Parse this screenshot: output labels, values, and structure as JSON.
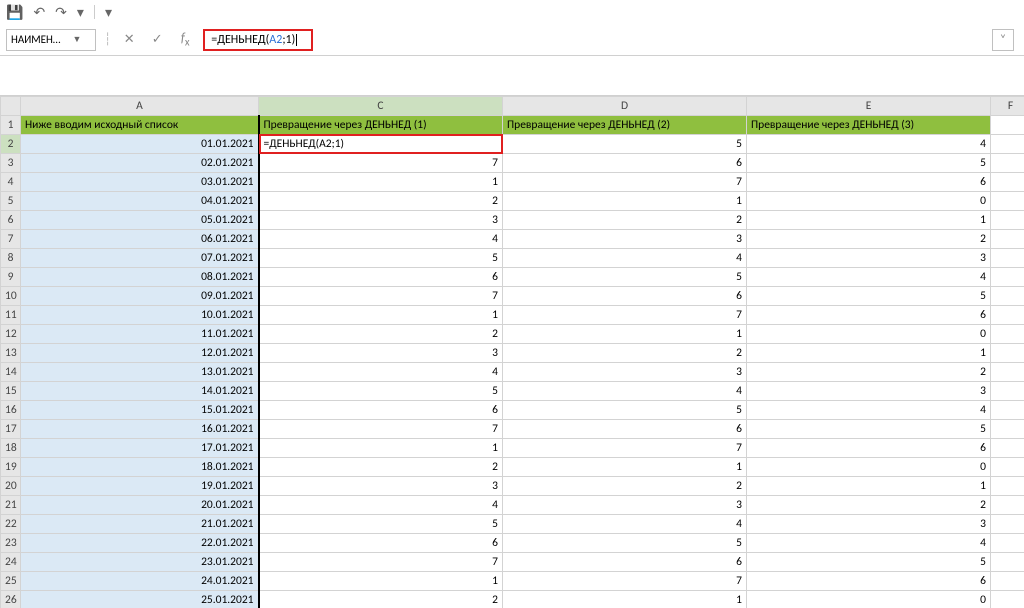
{
  "qat": {
    "save": "💾",
    "undo": "↶",
    "redo": "↷",
    "more": "⋯"
  },
  "namebox": {
    "value": "НАИМЕН…"
  },
  "formula": {
    "prefix": "=ДЕНЬНЕД(",
    "ref": "A2",
    "suffix": ";1)"
  },
  "columns": [
    "A",
    "C",
    "D",
    "E",
    "F"
  ],
  "headers": {
    "A": "Ниже вводим исходный список",
    "C": "Превращение через ДЕНЬНЕД (1)",
    "D": "Превращение через ДЕНЬНЕД (2)",
    "E": "Превращение через ДЕНЬНЕД (3)"
  },
  "inline_formula_cell": "=ДЕНЬНЕД(A2;1)",
  "rows": [
    {
      "n": 2,
      "A": "01.01.2021",
      "C": "",
      "D": "5",
      "E": "4"
    },
    {
      "n": 3,
      "A": "02.01.2021",
      "C": "7",
      "D": "6",
      "E": "5"
    },
    {
      "n": 4,
      "A": "03.01.2021",
      "C": "1",
      "D": "7",
      "E": "6"
    },
    {
      "n": 5,
      "A": "04.01.2021",
      "C": "2",
      "D": "1",
      "E": "0"
    },
    {
      "n": 6,
      "A": "05.01.2021",
      "C": "3",
      "D": "2",
      "E": "1"
    },
    {
      "n": 7,
      "A": "06.01.2021",
      "C": "4",
      "D": "3",
      "E": "2"
    },
    {
      "n": 8,
      "A": "07.01.2021",
      "C": "5",
      "D": "4",
      "E": "3"
    },
    {
      "n": 9,
      "A": "08.01.2021",
      "C": "6",
      "D": "5",
      "E": "4"
    },
    {
      "n": 10,
      "A": "09.01.2021",
      "C": "7",
      "D": "6",
      "E": "5"
    },
    {
      "n": 11,
      "A": "10.01.2021",
      "C": "1",
      "D": "7",
      "E": "6"
    },
    {
      "n": 12,
      "A": "11.01.2021",
      "C": "2",
      "D": "1",
      "E": "0"
    },
    {
      "n": 13,
      "A": "12.01.2021",
      "C": "3",
      "D": "2",
      "E": "1"
    },
    {
      "n": 14,
      "A": "13.01.2021",
      "C": "4",
      "D": "3",
      "E": "2"
    },
    {
      "n": 15,
      "A": "14.01.2021",
      "C": "5",
      "D": "4",
      "E": "3"
    },
    {
      "n": 16,
      "A": "15.01.2021",
      "C": "6",
      "D": "5",
      "E": "4"
    },
    {
      "n": 17,
      "A": "16.01.2021",
      "C": "7",
      "D": "6",
      "E": "5"
    },
    {
      "n": 18,
      "A": "17.01.2021",
      "C": "1",
      "D": "7",
      "E": "6"
    },
    {
      "n": 19,
      "A": "18.01.2021",
      "C": "2",
      "D": "1",
      "E": "0"
    },
    {
      "n": 20,
      "A": "19.01.2021",
      "C": "3",
      "D": "2",
      "E": "1"
    },
    {
      "n": 21,
      "A": "20.01.2021",
      "C": "4",
      "D": "3",
      "E": "2"
    },
    {
      "n": 22,
      "A": "21.01.2021",
      "C": "5",
      "D": "4",
      "E": "3"
    },
    {
      "n": 23,
      "A": "22.01.2021",
      "C": "6",
      "D": "5",
      "E": "4"
    },
    {
      "n": 24,
      "A": "23.01.2021",
      "C": "7",
      "D": "6",
      "E": "5"
    },
    {
      "n": 25,
      "A": "24.01.2021",
      "C": "1",
      "D": "7",
      "E": "6"
    },
    {
      "n": 26,
      "A": "25.01.2021",
      "C": "2",
      "D": "1",
      "E": "0"
    }
  ]
}
